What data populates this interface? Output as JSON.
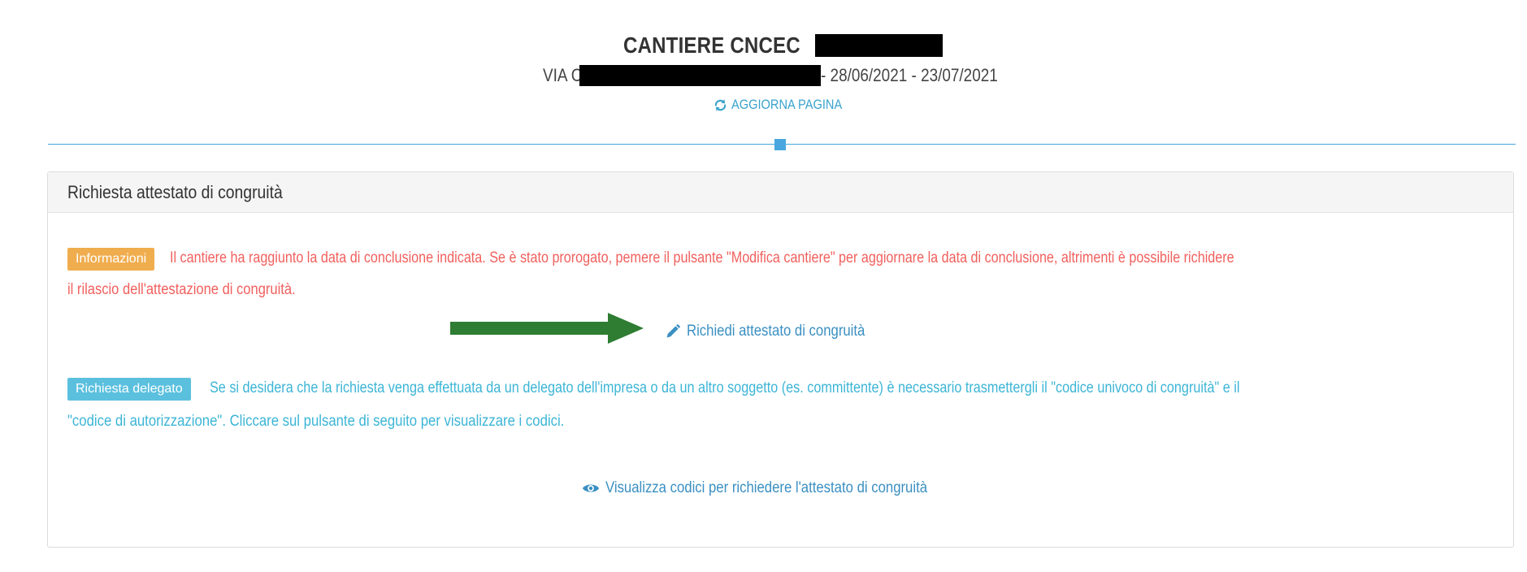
{
  "header": {
    "title": "CANTIERE CNCEC",
    "subtitle_prefix": "VIA C",
    "subtitle_dates": "- 28/06/2021 - 23/07/2021",
    "refresh_label": "AGGIORNA PAGINA"
  },
  "panel": {
    "title": "Richiesta attestato di congruità",
    "info": {
      "badge": "Informazioni",
      "line1": "Il cantiere ha raggiunto la data di conclusione indicata. Se è stato prorogato, pemere il pulsante \"Modifica cantiere\" per aggiornare la data di conclusione, altrimenti è possibile richidere",
      "line2": "il rilascio dell'attestazione di congruità."
    },
    "request_link": "Richiedi attestato di congruità",
    "delegate": {
      "badge": "Richiesta delegato",
      "line1": "Se si desidera che la richiesta venga effettuata da un delegato dell'impresa o da un altro soggetto (es. committente) è necessario trasmettergli il \"codice univoco di congruità\" e il",
      "line2": "\"codice di autorizzazione\". Cliccare sul pulsante di seguito per visualizzare i codici."
    },
    "codes_link": "Visualizza codici per richiedere l'attestato di congruità"
  },
  "colors": {
    "accent_blue": "#49a6df",
    "info_badge": "#f0ad4e",
    "delegate_badge": "#5bc0de",
    "info_text": "#f0605d",
    "delegate_text": "#3cb5d6",
    "arrow": "#2e7d32"
  },
  "icons": {
    "refresh": "refresh-icon",
    "pencil": "pencil-icon",
    "eye": "eye-icon",
    "arrow": "arrow-right-icon"
  }
}
